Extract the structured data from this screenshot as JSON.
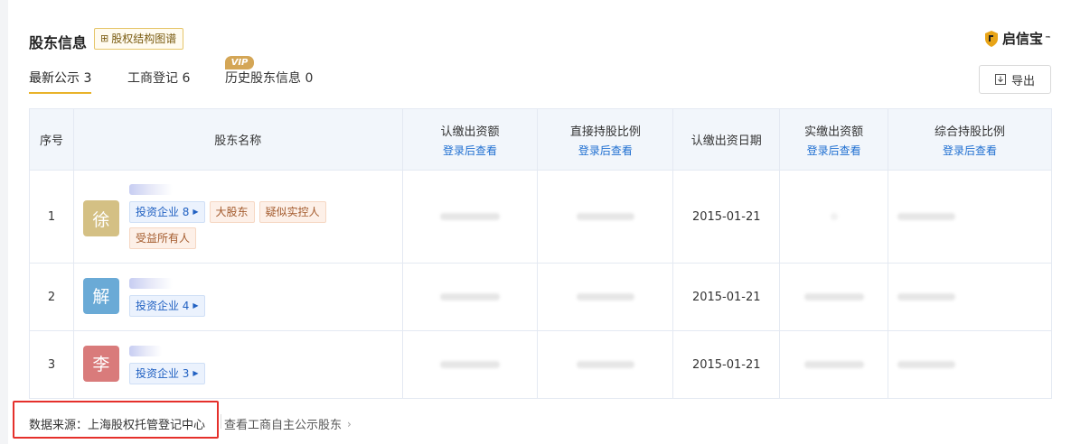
{
  "header": {
    "title": "股东信息",
    "chart_button": "股权结构图谱",
    "brand": "启信宝",
    "brand_tm": "™"
  },
  "tabs": [
    {
      "label": "最新公示 3",
      "active": true
    },
    {
      "label": "工商登记 6",
      "active": false
    },
    {
      "label": "历史股东信息 0",
      "active": false,
      "badge": "VIP"
    }
  ],
  "export_label": "导出",
  "table": {
    "columns": [
      "序号",
      "股东名称",
      "认缴出资额",
      "直接持股比例",
      "认缴出资日期",
      "实缴出资额",
      "综合持股比例"
    ],
    "login_hint": "登录后查看",
    "rows": [
      {
        "index": "1",
        "avatar": "徐",
        "avatar_color": "#d4c084",
        "invest": "投资企业 8",
        "tags": [
          "大股东",
          "疑似实控人",
          "受益所有人"
        ],
        "date": "2015-01-21"
      },
      {
        "index": "2",
        "avatar": "解",
        "avatar_color": "#6aaad6",
        "invest": "投资企业 4",
        "tags": [],
        "date": "2015-01-21"
      },
      {
        "index": "3",
        "avatar": "李",
        "avatar_color": "#d97b7b",
        "invest": "投资企业 3",
        "tags": [],
        "date": "2015-01-21"
      }
    ]
  },
  "footer": {
    "source": "数据来源：上海股权托管登记中心",
    "more_link": "查看工商自主公示股东"
  }
}
